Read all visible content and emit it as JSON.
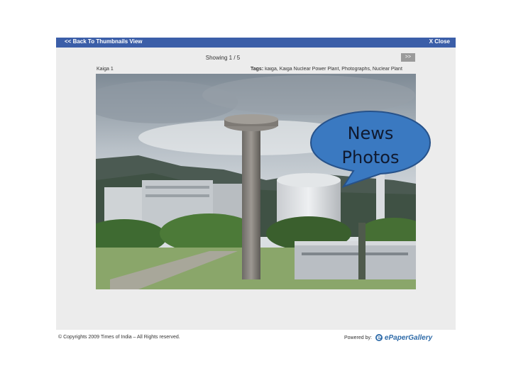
{
  "viewer": {
    "back_label": "<< Back To Thumbnails View",
    "close_label": "X Close",
    "counter": "Showing 1 / 5",
    "next_label": ">>",
    "caption": "Kaiga 1",
    "tags_label": "Tags:",
    "tags_value": "kaiga, Kaiga Nuclear Power Plant, Photographs, Nuclear Plant"
  },
  "footer": {
    "copyright": "© Copyrights 2009 Times of India – All Rights reserved.",
    "powered_by": "Powered by:",
    "brand": "ePaperGallery"
  },
  "overlay": {
    "line1": "News",
    "line2": "Photos",
    "fill_color": "#3a79c1",
    "stroke_color": "#27528a"
  },
  "colors": {
    "topbar": "#3b5ea8",
    "panel": "#ececec"
  }
}
